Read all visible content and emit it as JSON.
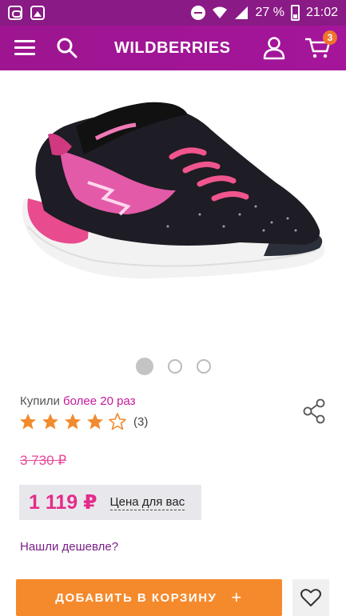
{
  "status_bar": {
    "battery_percent": "27 %",
    "time": "21:02"
  },
  "header": {
    "logo": "WILDBERRIES",
    "cart_count": "3"
  },
  "gallery": {
    "images_count": 3,
    "active_index": 0
  },
  "product": {
    "purchased_prefix": "Купили",
    "purchased_highlight": "более 20 раз",
    "rating_value": 4,
    "rating_max": 5,
    "reviews_count": "(3)",
    "old_price": "3 730 ₽",
    "price": "1 119 ₽",
    "price_note": "Цена для вас",
    "found_cheaper": "Нашли дешевле?"
  },
  "actions": {
    "add_to_cart_label": "ДОБАВИТЬ В КОРЗИНУ",
    "add_to_cart_plus": "+"
  },
  "colors": {
    "header": "#a4159a",
    "accent": "#e52b8a",
    "button": "#f58a2c",
    "star": "#f28a2e"
  }
}
